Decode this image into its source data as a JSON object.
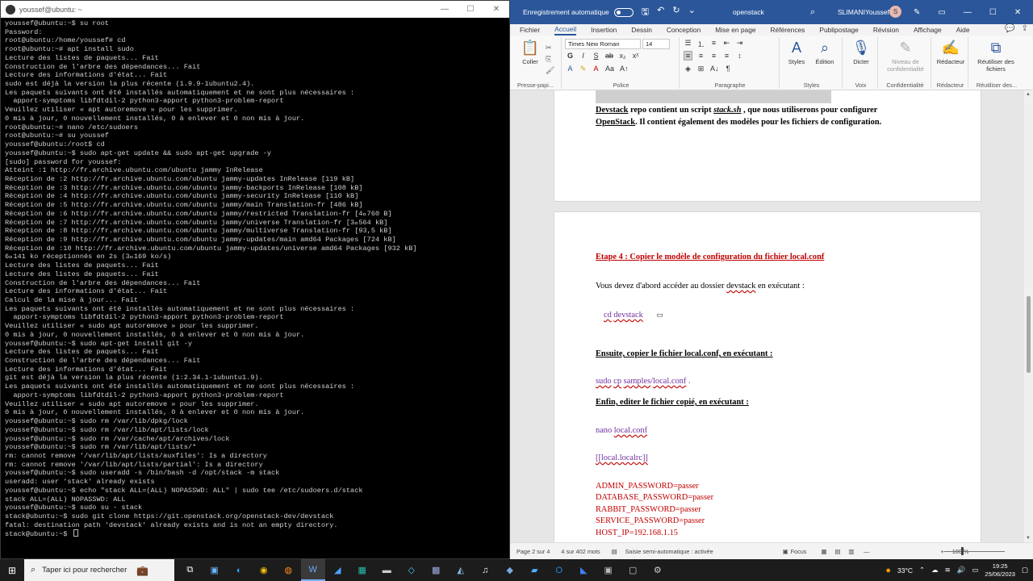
{
  "terminal": {
    "title": "youssef@ubuntu: ~",
    "lines": [
      "youssef@ubuntu:~$ su root",
      "Password:",
      "root@ubuntu:/home/youssef# cd",
      "root@ubuntu:~# apt install sudo",
      "Lecture des listes de paquets... Fait",
      "Construction de l'arbre des dépendances... Fait",
      "Lecture des informations d'état... Fait",
      "sudo est déjà la version la plus récente (1.9.9-1ubuntu2.4).",
      "Les paquets suivants ont été installés automatiquement et ne sont plus nécessaires :",
      "  apport-symptoms libfdtdil-2 python3-apport python3-problem-report",
      "Veuillez utiliser « apt autoremove » pour les supprimer.",
      "0 mis à jour, 0 nouvellement installés, 0 à enlever et 0 non mis à jour.",
      "root@ubuntu:~# nano /etc/sudoers",
      "root@ubuntu:~# su youssef",
      "youssef@ubuntu:/root$ cd",
      "youssef@ubuntu:~$ sudo apt-get update && sudo apt-get upgrade -y",
      "[sudo] password for youssef:",
      "Atteint :1 http://fr.archive.ubuntu.com/ubuntu jammy InRelease",
      "Réception de :2 http://fr.archive.ubuntu.com/ubuntu jammy-updates InRelease [119 kB]",
      "Réception de :3 http://fr.archive.ubuntu.com/ubuntu jammy-backports InRelease [108 kB]",
      "Réception de :4 http://fr.archive.ubuntu.com/ubuntu jammy-security InRelease [110 kB]",
      "Réception de :5 http://fr.archive.ubuntu.com/ubuntu jammy/main Translation-fr [486 kB]",
      "Réception de :6 http://fr.archive.ubuntu.com/ubuntu jammy/restricted Translation-fr [4\u0000760 B]",
      "Réception de :7 http://fr.archive.ubuntu.com/ubuntu jammy/universe Translation-fr [3\u0000564 kB]",
      "Réception de :8 http://fr.archive.ubuntu.com/ubuntu jammy/multiverse Translation-fr [93,5 kB]",
      "Réception de :9 http://fr.archive.ubuntu.com/ubuntu jammy-updates/main amd64 Packages [724 kB]",
      "Réception de :10 http://fr.archive.ubuntu.com/ubuntu jammy-updates/universe amd64 Packages [932 kB]",
      "6\u0000141 ko réceptionnés en 2s (3\u0000169 ko/s)",
      "Lecture des listes de paquets... Fait",
      "Lecture des listes de paquets... Fait",
      "Construction de l'arbre des dépendances... Fait",
      "Lecture des informations d'état... Fait",
      "Calcul de la mise à jour... Fait",
      "Les paquets suivants ont été installés automatiquement et ne sont plus nécessaires :",
      "  apport-symptoms libfdtdil-2 python3-apport python3-problem-report",
      "Veuillez utiliser « sudo apt autoremove » pour les supprimer.",
      "0 mis à jour, 0 nouvellement installés, 0 à enlever et 0 non mis à jour.",
      "youssef@ubuntu:~$ sudo apt-get install git -y",
      "Lecture des listes de paquets... Fait",
      "Construction de l'arbre des dépendances... Fait",
      "Lecture des informations d'état... Fait",
      "git est déjà la version la plus récente (1:2.34.1-1ubuntu1.9).",
      "Les paquets suivants ont été installés automatiquement et ne sont plus nécessaires :",
      "  apport-symptoms libfdtdil-2 python3-apport python3-problem-report",
      "Veuillez utiliser « sudo apt autoremove » pour les supprimer.",
      "0 mis à jour, 0 nouvellement installés, 0 à enlever et 0 non mis à jour.",
      "youssef@ubuntu:~$ sudo rm /var/lib/dpkg/lock",
      "youssef@ubuntu:~$ sudo rm /var/lib/apt/lists/lock",
      "youssef@ubuntu:~$ sudo rm /var/cache/apt/archives/lock",
      "youssef@ubuntu:~$ sudo rm /var/lib/apt/lists/*",
      "rm: cannot remove '/var/lib/apt/lists/auxfiles': Is a directory",
      "rm: cannot remove '/var/lib/apt/lists/partial': Is a directory",
      "youssef@ubuntu:~$ sudo useradd -s /bin/bash -d /opt/stack -m stack",
      "useradd: user 'stack' already exists",
      "youssef@ubuntu:~$ echo \"stack ALL=(ALL) NOPASSWD: ALL\" | sudo tee /etc/sudoers.d/stack",
      "stack ALL=(ALL) NOPASSWD: ALL",
      "youssef@ubuntu:~$ sudo su - stack",
      "stack@ubuntu:~$ sudo git clone https://git.openstack.org/openstack-dev/devstack",
      "fatal: destination path 'devstack' already exists and is not an empty directory.",
      "stack@ubuntu:~$ "
    ]
  },
  "word": {
    "autosave_label": "Enregistrement automatique",
    "doc_name": "openstack",
    "user_name": "SLIMANIYoussef",
    "avatar_initial": "S",
    "tabs": [
      "Fichier",
      "Accueil",
      "Insertion",
      "Dessin",
      "Conception",
      "Mise en page",
      "Références",
      "Publipostage",
      "Révision",
      "Affichage",
      "Aide"
    ],
    "ribbon": {
      "paste_label": "Coller",
      "font_name": "Times New Roman",
      "font_size": "14",
      "styles_label": "Styles",
      "edit_label": "Édition",
      "dictate_label": "Dicter",
      "sensitivity_label": "Niveau de confidentialité",
      "editor_label": "Rédacteur",
      "reuse_label": "Réutiliser des fichiers",
      "groups": {
        "clipboard": "Presse-papi...",
        "font": "Police",
        "paragraph": "Paragraphe",
        "styles": "Styles",
        "voice": "Voix",
        "sensitivity": "Confidentialité",
        "editor": "Rédacteur",
        "reuse": "Réutiliser des..."
      }
    },
    "doc": {
      "p1_l1_a": "Devstack",
      "p1_l1_b": " repo contient un script ",
      "p1_l1_c": "stack.sh",
      "p1_l1_d": " , que nous utiliserons pour configurer",
      "p1_l2_a": "OpenStack",
      "p1_l2_b": ". Il contient également des modèles pour les fichiers de configuration.",
      "step4": "Etape 4 : Copier le modèle de configuration du fichier local.conf",
      "intro_a": "Vous devez d'abord accéder au dossier ",
      "intro_b": "devstack",
      "intro_c": " en exécutant :",
      "cmd1_a": "cd",
      "cmd1_b": "devstack",
      "then_copy": "Ensuite, copier le fichier local.conf, en exécutant :",
      "cmd2_a": "sudo",
      "cmd2_b": "cp",
      "cmd2_c": "samples",
      "cmd2_d": "/",
      "cmd2_e": "local.conf",
      "cmd2_f": " .",
      "finally_edit": "Enfin, editer le fichier copié, en exécutant :",
      "cmd3_a": "nano ",
      "cmd3_b": "local.conf",
      "localrc": "[[local.localrc]]",
      "passwords": [
        "ADMIN_PASSWORD=passer",
        "DATABASE_PASSWORD=passer",
        "RABBIT_PASSWORD=passer",
        "SERVICE_PASSWORD=passer",
        "HOST_IP=192.168.1.15"
      ]
    },
    "status": {
      "page": "Page 2 sur 4",
      "words": "4 sur 402 mots",
      "autocorrect": "Saisie semi-automatique : activée",
      "focus": "Focus",
      "zoom": "100 %"
    }
  },
  "taskbar": {
    "search_placeholder": "Taper ici pour rechercher",
    "weather": "33°C",
    "time": "19:25",
    "date": "25/06/2023"
  },
  "icons": {
    "terminal": "terminal-icon",
    "word": "word-icon",
    "search": "search-icon"
  }
}
